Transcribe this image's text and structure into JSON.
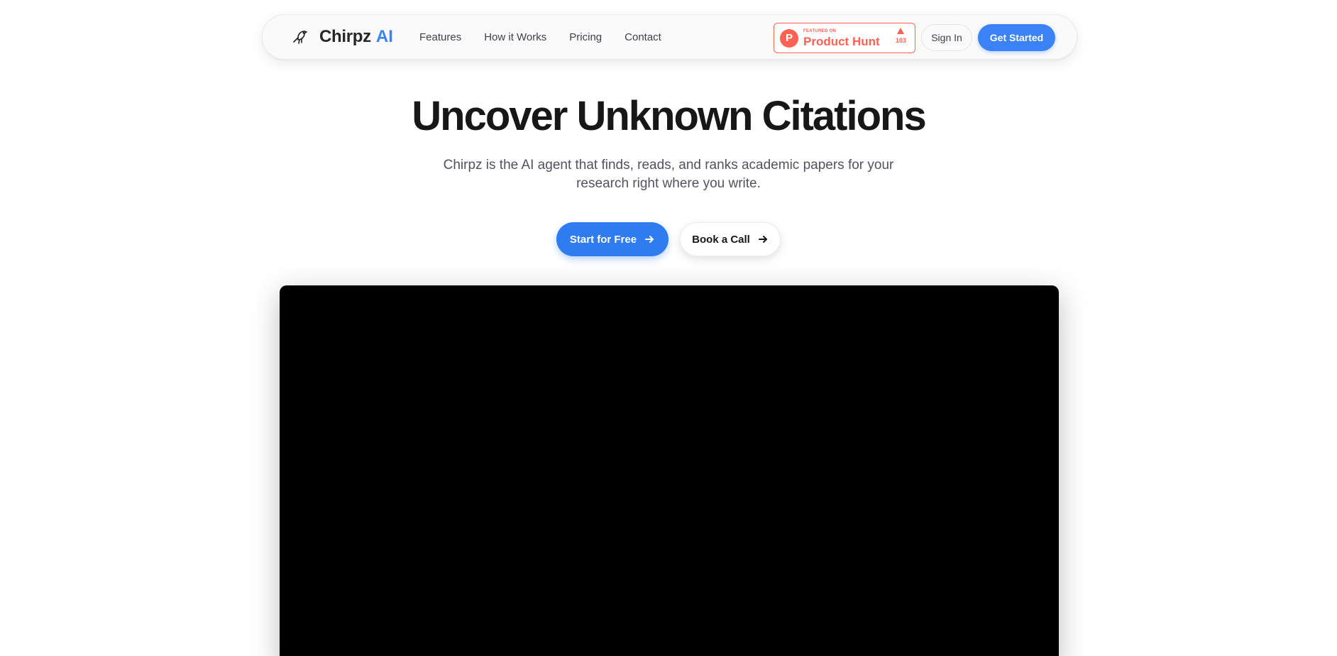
{
  "brand": {
    "name": "Chirpz",
    "accent": "AI",
    "icon": "bird-icon"
  },
  "nav": {
    "links": [
      {
        "label": "Features"
      },
      {
        "label": "How it Works"
      },
      {
        "label": "Pricing"
      },
      {
        "label": "Contact"
      }
    ],
    "product_hunt": {
      "small": "FEATURED ON",
      "big": "Product Hunt",
      "votes": "103",
      "logo_letter": "P"
    },
    "sign_in": "Sign In",
    "get_started": "Get Started"
  },
  "hero": {
    "title": "Uncover Unknown Citations",
    "subtitle": "Chirpz is the AI agent that finds, reads, and ranks academic papers for your research right where you write.",
    "primary_cta": "Start for Free",
    "secondary_cta": "Book a Call"
  },
  "colors": {
    "accent": "#3b82f6",
    "product_hunt": "#ff6154",
    "video_bg": "#000000"
  }
}
